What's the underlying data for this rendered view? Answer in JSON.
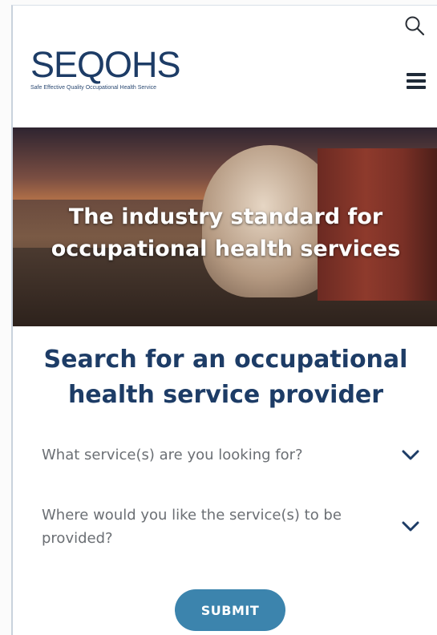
{
  "header": {
    "logo_text": "SEQOHS",
    "logo_tagline": "Safe Effective Quality Occupational Health Service",
    "search_icon": "search-icon",
    "menu_icon": "hamburger-menu-icon"
  },
  "hero": {
    "title_line1": "The industry standard for",
    "title_line2": "occupational health services"
  },
  "search_form": {
    "title_line1": "Search for an occupational",
    "title_line2": "health service provider",
    "services_dropdown": {
      "label": "What service(s) are you looking for?",
      "icon": "chevron-down-icon"
    },
    "location_dropdown": {
      "label_line1": "Where would you like the service(s) to be",
      "label_line2": "provided?",
      "icon": "chevron-down-icon"
    },
    "submit_label": "SUBMIT"
  },
  "colors": {
    "brand_navy": "#1d3c66",
    "button_blue": "#3c84ad",
    "label_gray": "#6b6f74"
  }
}
